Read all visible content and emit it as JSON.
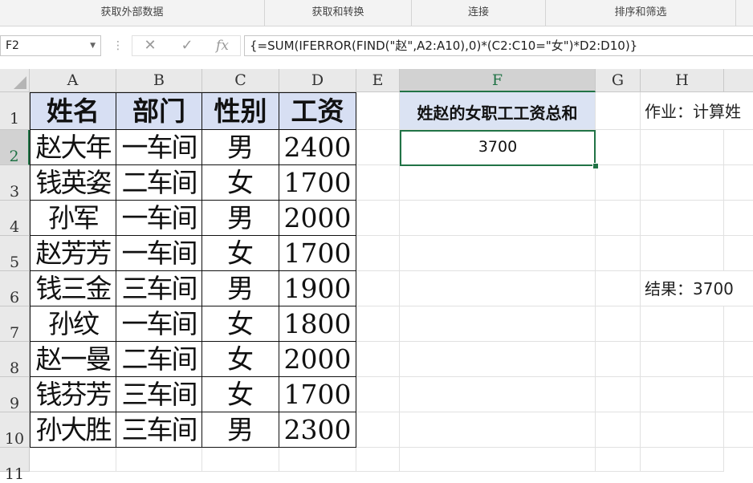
{
  "ribbon": {
    "groups": [
      "获取外部数据",
      "获取和转换",
      "连接",
      "排序和筛选"
    ]
  },
  "formula_bar": {
    "name_box": "F2",
    "cancel_icon": "✕",
    "enter_icon": "✓",
    "fx_icon": "fx",
    "formula": "{=SUM(IFERROR(FIND(\"赵\",A2:A10),0)*(C2:C10=\"女\")*D2:D10)}"
  },
  "columns": [
    "A",
    "B",
    "C",
    "D",
    "E",
    "F",
    "G",
    "H"
  ],
  "rows": [
    "1",
    "2",
    "3",
    "4",
    "5",
    "6",
    "7",
    "8",
    "9",
    "10",
    "11"
  ],
  "table": {
    "headers": [
      "姓名",
      "部门",
      "性别",
      "工资"
    ],
    "rows": [
      [
        "赵大年",
        "一车间",
        "男",
        "2400"
      ],
      [
        "钱英姿",
        "二车间",
        "女",
        "1700"
      ],
      [
        "孙军",
        "一车间",
        "男",
        "2000"
      ],
      [
        "赵芳芳",
        "一车间",
        "女",
        "1700"
      ],
      [
        "钱三金",
        "三车间",
        "男",
        "1900"
      ],
      [
        "孙纹",
        "一车间",
        "女",
        "1800"
      ],
      [
        "赵一曼",
        "二车间",
        "女",
        "2000"
      ],
      [
        "钱芬芳",
        "三车间",
        "女",
        "1700"
      ],
      [
        "孙大胜",
        "三车间",
        "男",
        "2300"
      ]
    ]
  },
  "result_block": {
    "header": "姓赵的女职工工资总和",
    "value": "3700"
  },
  "notes": {
    "task": "作业：计算姓",
    "result": "结果：3700"
  },
  "colors": {
    "accent": "#217346",
    "table_header_bg": "#d7dff3",
    "ribbon_bg": "#f3f3f3"
  }
}
